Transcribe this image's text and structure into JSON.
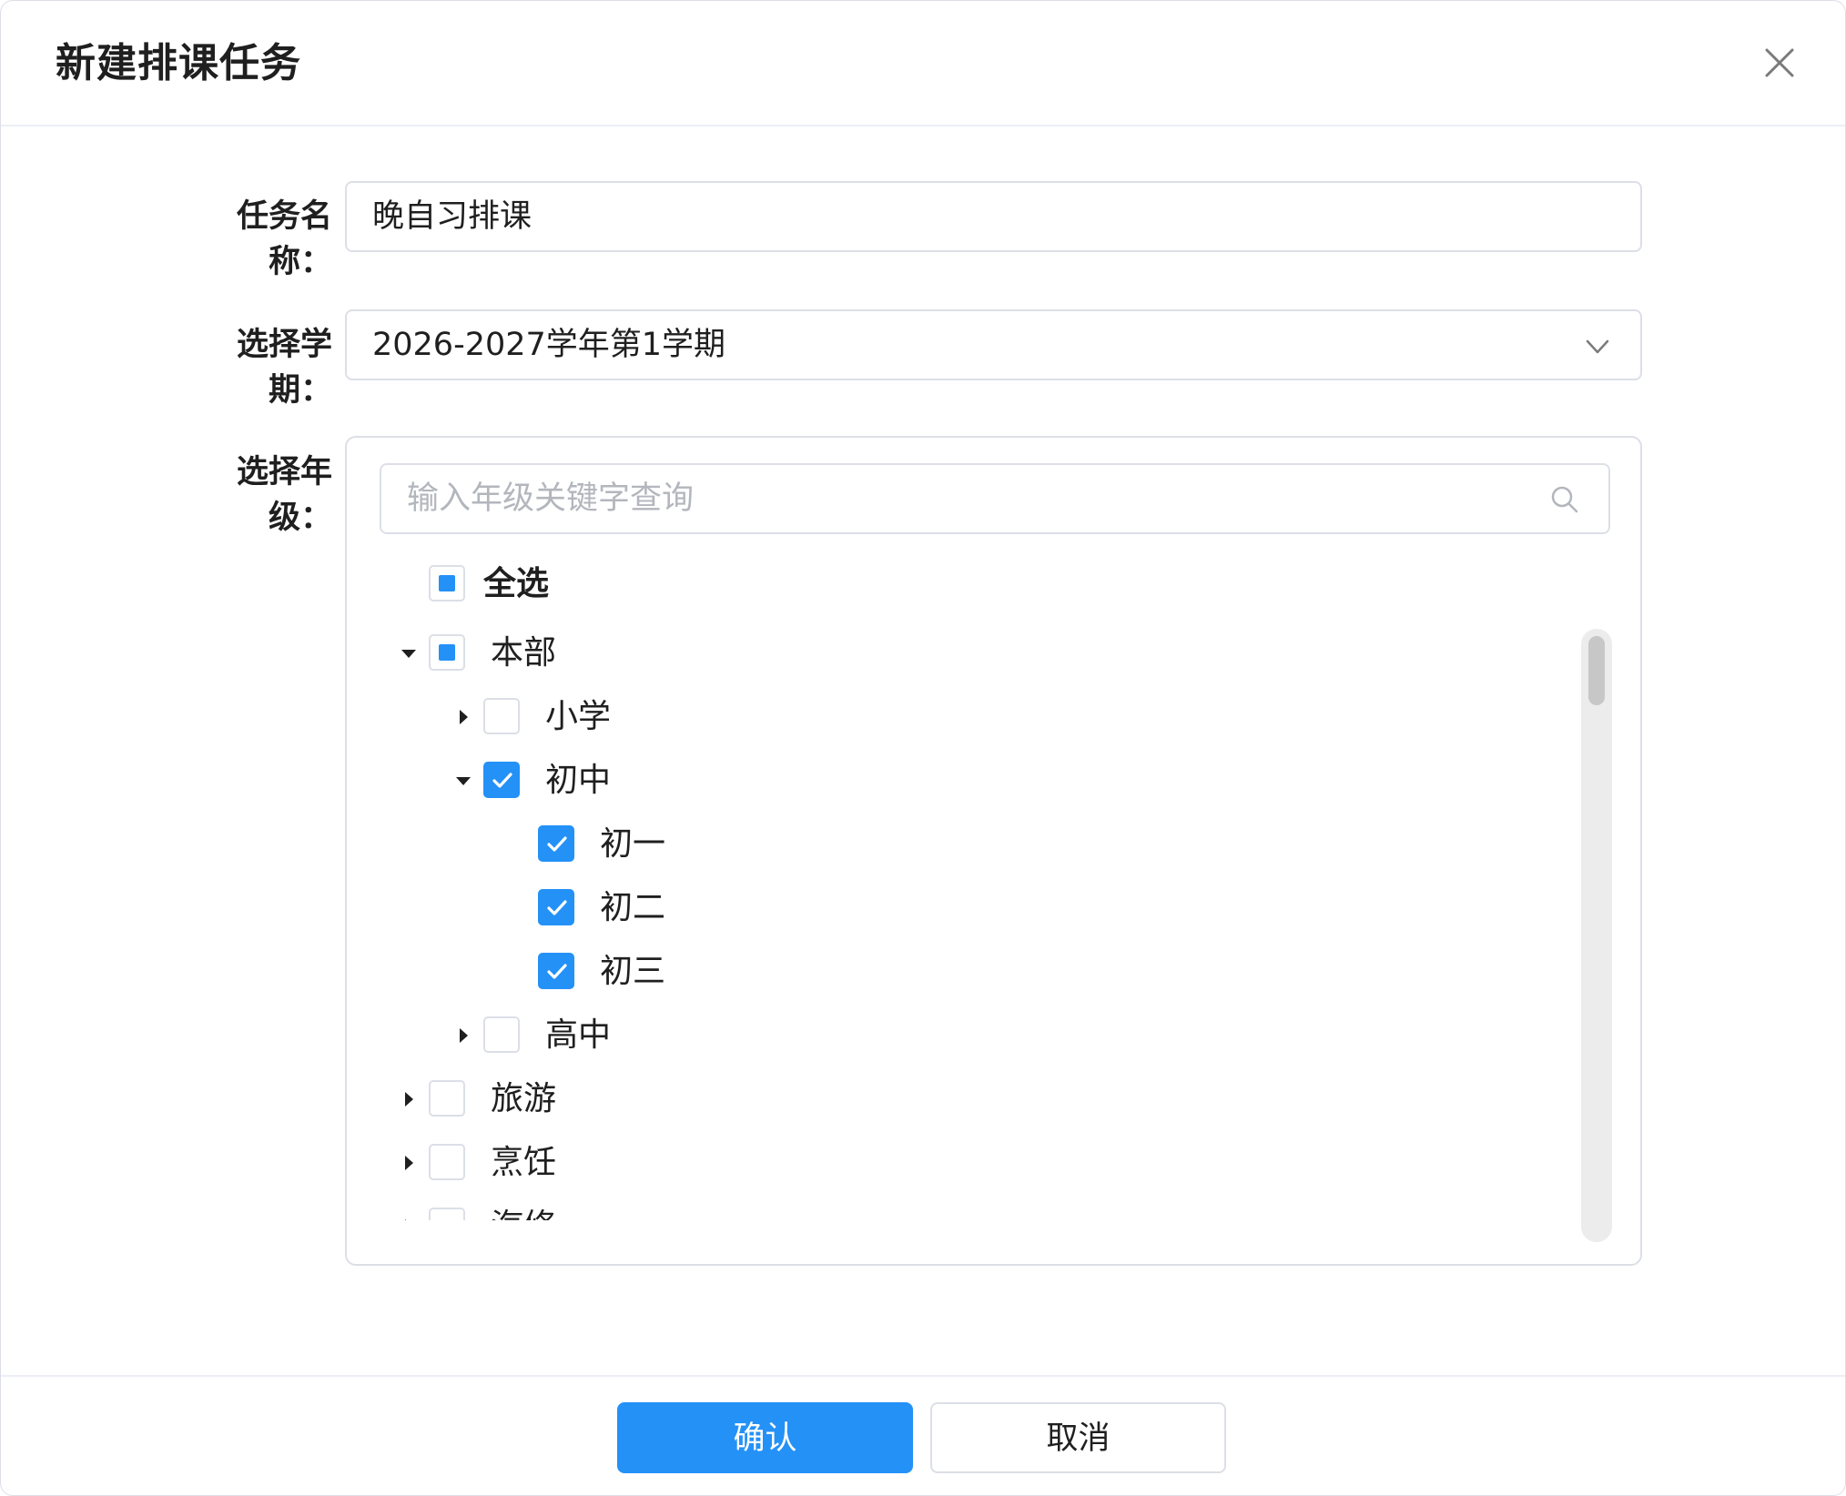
{
  "dialog": {
    "title": "新建排课任务",
    "close_icon": "close-icon"
  },
  "form": {
    "task_name": {
      "label": "任务名称：",
      "value": "晚自习排课"
    },
    "semester": {
      "label": "选择学期：",
      "value": "2026-2027学年第1学期",
      "icon": "chevron-down-icon"
    },
    "grade": {
      "label": "选择年级：",
      "search": {
        "placeholder": "输入年级关键字查询",
        "icon": "search-icon"
      },
      "select_all": {
        "label": "全选",
        "state": "indeterminate"
      },
      "tree": [
        {
          "label": "本部",
          "level": 0,
          "expanded": true,
          "state": "indeterminate",
          "has_children": true
        },
        {
          "label": "小学",
          "level": 1,
          "expanded": false,
          "state": "unchecked",
          "has_children": true
        },
        {
          "label": "初中",
          "level": 1,
          "expanded": true,
          "state": "checked",
          "has_children": true
        },
        {
          "label": "初一",
          "level": 2,
          "state": "checked",
          "has_children": false
        },
        {
          "label": "初二",
          "level": 2,
          "state": "checked",
          "has_children": false
        },
        {
          "label": "初三",
          "level": 2,
          "state": "checked",
          "has_children": false
        },
        {
          "label": "高中",
          "level": 1,
          "expanded": false,
          "state": "unchecked",
          "has_children": true
        },
        {
          "label": "旅游",
          "level": 0,
          "expanded": false,
          "state": "unchecked",
          "has_children": true
        },
        {
          "label": "烹饪",
          "level": 0,
          "expanded": false,
          "state": "unchecked",
          "has_children": true
        },
        {
          "label": "汽修",
          "level": 0,
          "expanded": false,
          "state": "unchecked",
          "has_children": true
        }
      ]
    }
  },
  "footer": {
    "confirm_label": "确认",
    "cancel_label": "取消"
  },
  "colors": {
    "accent": "#2491f7",
    "border": "#dcdfe6",
    "text": "#1f1f1f",
    "placeholder": "#b3b6bc"
  }
}
